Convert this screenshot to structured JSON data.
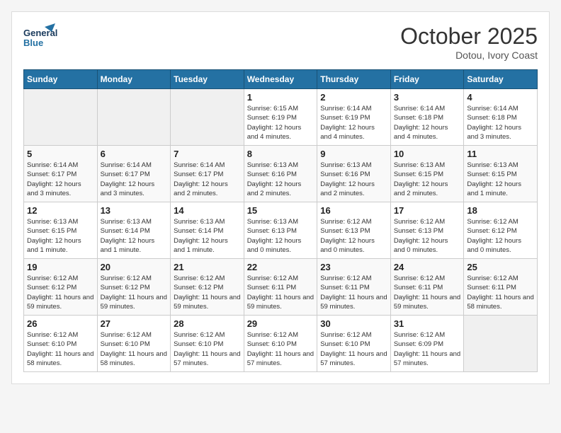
{
  "header": {
    "logo_line1": "General",
    "logo_line2": "Blue",
    "month": "October 2025",
    "location": "Dotou, Ivory Coast"
  },
  "weekdays": [
    "Sunday",
    "Monday",
    "Tuesday",
    "Wednesday",
    "Thursday",
    "Friday",
    "Saturday"
  ],
  "weeks": [
    [
      {
        "day": "",
        "info": ""
      },
      {
        "day": "",
        "info": ""
      },
      {
        "day": "",
        "info": ""
      },
      {
        "day": "1",
        "info": "Sunrise: 6:15 AM\nSunset: 6:19 PM\nDaylight: 12 hours and 4 minutes."
      },
      {
        "day": "2",
        "info": "Sunrise: 6:14 AM\nSunset: 6:19 PM\nDaylight: 12 hours and 4 minutes."
      },
      {
        "day": "3",
        "info": "Sunrise: 6:14 AM\nSunset: 6:18 PM\nDaylight: 12 hours and 4 minutes."
      },
      {
        "day": "4",
        "info": "Sunrise: 6:14 AM\nSunset: 6:18 PM\nDaylight: 12 hours and 3 minutes."
      }
    ],
    [
      {
        "day": "5",
        "info": "Sunrise: 6:14 AM\nSunset: 6:17 PM\nDaylight: 12 hours and 3 minutes."
      },
      {
        "day": "6",
        "info": "Sunrise: 6:14 AM\nSunset: 6:17 PM\nDaylight: 12 hours and 3 minutes."
      },
      {
        "day": "7",
        "info": "Sunrise: 6:14 AM\nSunset: 6:17 PM\nDaylight: 12 hours and 2 minutes."
      },
      {
        "day": "8",
        "info": "Sunrise: 6:13 AM\nSunset: 6:16 PM\nDaylight: 12 hours and 2 minutes."
      },
      {
        "day": "9",
        "info": "Sunrise: 6:13 AM\nSunset: 6:16 PM\nDaylight: 12 hours and 2 minutes."
      },
      {
        "day": "10",
        "info": "Sunrise: 6:13 AM\nSunset: 6:15 PM\nDaylight: 12 hours and 2 minutes."
      },
      {
        "day": "11",
        "info": "Sunrise: 6:13 AM\nSunset: 6:15 PM\nDaylight: 12 hours and 1 minute."
      }
    ],
    [
      {
        "day": "12",
        "info": "Sunrise: 6:13 AM\nSunset: 6:15 PM\nDaylight: 12 hours and 1 minute."
      },
      {
        "day": "13",
        "info": "Sunrise: 6:13 AM\nSunset: 6:14 PM\nDaylight: 12 hours and 1 minute."
      },
      {
        "day": "14",
        "info": "Sunrise: 6:13 AM\nSunset: 6:14 PM\nDaylight: 12 hours and 1 minute."
      },
      {
        "day": "15",
        "info": "Sunrise: 6:13 AM\nSunset: 6:13 PM\nDaylight: 12 hours and 0 minutes."
      },
      {
        "day": "16",
        "info": "Sunrise: 6:12 AM\nSunset: 6:13 PM\nDaylight: 12 hours and 0 minutes."
      },
      {
        "day": "17",
        "info": "Sunrise: 6:12 AM\nSunset: 6:13 PM\nDaylight: 12 hours and 0 minutes."
      },
      {
        "day": "18",
        "info": "Sunrise: 6:12 AM\nSunset: 6:12 PM\nDaylight: 12 hours and 0 minutes."
      }
    ],
    [
      {
        "day": "19",
        "info": "Sunrise: 6:12 AM\nSunset: 6:12 PM\nDaylight: 11 hours and 59 minutes."
      },
      {
        "day": "20",
        "info": "Sunrise: 6:12 AM\nSunset: 6:12 PM\nDaylight: 11 hours and 59 minutes."
      },
      {
        "day": "21",
        "info": "Sunrise: 6:12 AM\nSunset: 6:12 PM\nDaylight: 11 hours and 59 minutes."
      },
      {
        "day": "22",
        "info": "Sunrise: 6:12 AM\nSunset: 6:11 PM\nDaylight: 11 hours and 59 minutes."
      },
      {
        "day": "23",
        "info": "Sunrise: 6:12 AM\nSunset: 6:11 PM\nDaylight: 11 hours and 59 minutes."
      },
      {
        "day": "24",
        "info": "Sunrise: 6:12 AM\nSunset: 6:11 PM\nDaylight: 11 hours and 59 minutes."
      },
      {
        "day": "25",
        "info": "Sunrise: 6:12 AM\nSunset: 6:11 PM\nDaylight: 11 hours and 58 minutes."
      }
    ],
    [
      {
        "day": "26",
        "info": "Sunrise: 6:12 AM\nSunset: 6:10 PM\nDaylight: 11 hours and 58 minutes."
      },
      {
        "day": "27",
        "info": "Sunrise: 6:12 AM\nSunset: 6:10 PM\nDaylight: 11 hours and 58 minutes."
      },
      {
        "day": "28",
        "info": "Sunrise: 6:12 AM\nSunset: 6:10 PM\nDaylight: 11 hours and 57 minutes."
      },
      {
        "day": "29",
        "info": "Sunrise: 6:12 AM\nSunset: 6:10 PM\nDaylight: 11 hours and 57 minutes."
      },
      {
        "day": "30",
        "info": "Sunrise: 6:12 AM\nSunset: 6:10 PM\nDaylight: 11 hours and 57 minutes."
      },
      {
        "day": "31",
        "info": "Sunrise: 6:12 AM\nSunset: 6:09 PM\nDaylight: 11 hours and 57 minutes."
      },
      {
        "day": "",
        "info": ""
      }
    ]
  ]
}
